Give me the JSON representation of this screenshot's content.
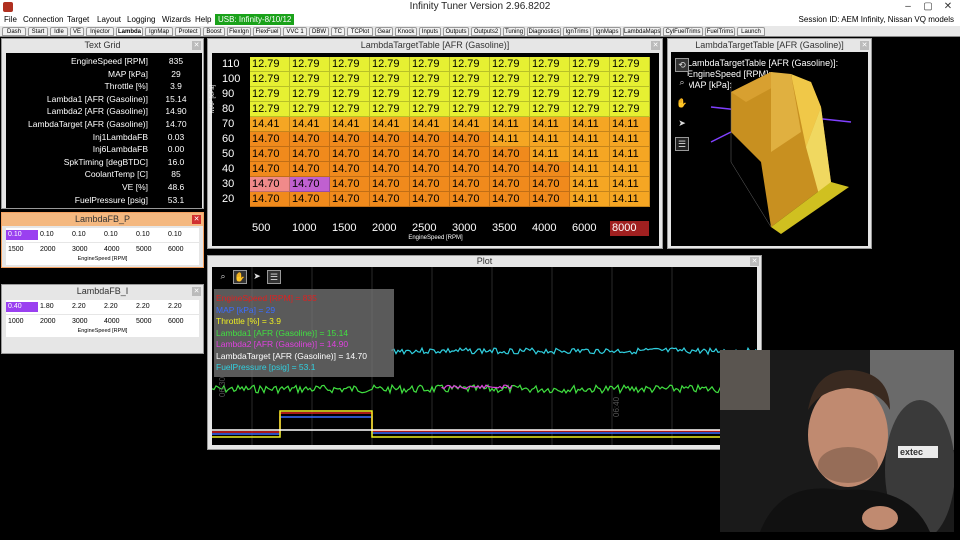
{
  "window": {
    "title": "Infinity Tuner Version 2.96.8202",
    "min": "–",
    "max": "▢",
    "close": "✕"
  },
  "menu": {
    "items": [
      "File",
      "Connection",
      "Target",
      "Layout",
      "Logging",
      "Wizards",
      "Help"
    ],
    "usb": "USB: Infinity-8/10/12",
    "session": "Session ID: AEM Infinity, Nissan VQ models"
  },
  "tabs": [
    "Dash",
    "Start",
    "Idle",
    "VE",
    "Injector",
    "Lambda",
    "IgnMap",
    "Protect",
    "Boost",
    "FlexIgn",
    "FlexFuel",
    "VVC 1",
    "DBW",
    "TC",
    "TCPlot",
    "Gear",
    "Knock",
    "Inputs",
    "Outputs",
    "Outputs2",
    "Tuning",
    "Diagnostics",
    "IgnTrims",
    "IgnMaps",
    "LambdaMaps",
    "CylFuelTrims",
    "FuelTrims",
    "Launch"
  ],
  "active_tab": "Lambda",
  "text_grid": {
    "title": "Text Grid",
    "rows": [
      {
        "name": "EngineSpeed [RPM]",
        "value": "835"
      },
      {
        "name": "MAP [kPa]",
        "value": "29"
      },
      {
        "name": "Throttle [%]",
        "value": "3.9"
      },
      {
        "name": "Lambda1 [AFR (Gasoline)]",
        "value": "15.14"
      },
      {
        "name": "Lambda2 [AFR (Gasoline)]",
        "value": "14.90"
      },
      {
        "name": "LambdaTarget [AFR (Gasoline)]",
        "value": "14.70"
      },
      {
        "name": "Inj1LambdaFB",
        "value": "0.03"
      },
      {
        "name": "Inj6LambdaFB",
        "value": "0.00"
      },
      {
        "name": "SpkTiming [degBTDC]",
        "value": "16.0"
      },
      {
        "name": "CoolantTemp [C]",
        "value": "85"
      },
      {
        "name": "VE [%]",
        "value": "48.6"
      },
      {
        "name": "FuelPressure [psig]",
        "value": "53.1"
      }
    ]
  },
  "lambda_fb_p": {
    "title": "LambdaFB_P",
    "values": [
      "0.10",
      "0.10",
      "0.10",
      "0.10",
      "0.10",
      "0.10"
    ],
    "axis": [
      "1500",
      "2000",
      "3000",
      "4000",
      "5000",
      "6000"
    ],
    "axis_label": "EngineSpeed [RPM]"
  },
  "lambda_fb_i": {
    "title": "LambdaFB_I",
    "values": [
      "0.40",
      "1.80",
      "2.20",
      "2.20",
      "2.20",
      "2.20"
    ],
    "axis": [
      "1000",
      "2000",
      "3000",
      "4000",
      "5000",
      "6000"
    ],
    "axis_label": "EngineSpeed [RPM]"
  },
  "lambda_table": {
    "title": "LambdaTargetTable [AFR (Gasoline)]",
    "y_axis": [
      "110",
      "100",
      "90",
      "80",
      "70",
      "60",
      "50",
      "40",
      "30",
      "20"
    ],
    "y_label": "MAP [kPa]",
    "x_axis": [
      "500",
      "1000",
      "1500",
      "2000",
      "2500",
      "3000",
      "3500",
      "4000",
      "6000",
      "8000"
    ],
    "x_label": "EngineSpeed [RPM]",
    "rows": [
      [
        "12.79",
        "12.79",
        "12.79",
        "12.79",
        "12.79",
        "12.79",
        "12.79",
        "12.79",
        "12.79",
        "12.79"
      ],
      [
        "12.79",
        "12.79",
        "12.79",
        "12.79",
        "12.79",
        "12.79",
        "12.79",
        "12.79",
        "12.79",
        "12.79"
      ],
      [
        "12.79",
        "12.79",
        "12.79",
        "12.79",
        "12.79",
        "12.79",
        "12.79",
        "12.79",
        "12.79",
        "12.79"
      ],
      [
        "12.79",
        "12.79",
        "12.79",
        "12.79",
        "12.79",
        "12.79",
        "12.79",
        "12.79",
        "12.79",
        "12.79"
      ],
      [
        "14.41",
        "14.41",
        "14.41",
        "14.41",
        "14.41",
        "14.41",
        "14.11",
        "14.11",
        "14.11",
        "14.11"
      ],
      [
        "14.70",
        "14.70",
        "14.70",
        "14.70",
        "14.70",
        "14.70",
        "14.11",
        "14.11",
        "14.11",
        "14.11"
      ],
      [
        "14.70",
        "14.70",
        "14.70",
        "14.70",
        "14.70",
        "14.70",
        "14.70",
        "14.11",
        "14.11",
        "14.11"
      ],
      [
        "14.70",
        "14.70",
        "14.70",
        "14.70",
        "14.70",
        "14.70",
        "14.70",
        "14.70",
        "14.11",
        "14.11"
      ],
      [
        "14.70",
        "14.70",
        "14.70",
        "14.70",
        "14.70",
        "14.70",
        "14.70",
        "14.70",
        "14.11",
        "14.11"
      ],
      [
        "14.70",
        "14.70",
        "14.70",
        "14.70",
        "14.70",
        "14.70",
        "14.70",
        "14.70",
        "14.11",
        "14.11"
      ]
    ],
    "colors": {
      "rich": "#e6f032",
      "lean": "#f08a1c",
      "mid": "#f5a623",
      "selected": "#c060d0"
    }
  },
  "plot3d": {
    "title": "LambdaTargetTable [AFR (Gasoline)]",
    "lines": [
      "LambdaTargetTable [AFR (Gasoline)]:",
      "EngineSpeed [RPM]:",
      "MAP [kPa]:"
    ]
  },
  "plot": {
    "title": "Plot",
    "legend": [
      {
        "text": "EngineSpeed [RPM] = 835",
        "color": "#e02020"
      },
      {
        "text": "MAP [kPa] = 29",
        "color": "#3a6cff"
      },
      {
        "text": "Throttle [%] = 3.9",
        "color": "#f0f020"
      },
      {
        "text": "Lambda1 [AFR (Gasoline)] = 15.14",
        "color": "#40e040"
      },
      {
        "text": "Lambda2 [AFR (Gasoline)] = 14.90",
        "color": "#e040e0"
      },
      {
        "text": "LambdaTarget [AFR (Gasoline)] = 14.70",
        "color": "#ffffff"
      },
      {
        "text": "FuelPressure [psig] = 53.1",
        "color": "#30d0e0"
      }
    ],
    "time_labels": [
      "06:30",
      "06:40"
    ]
  },
  "webcam": {
    "badge": "extec"
  }
}
